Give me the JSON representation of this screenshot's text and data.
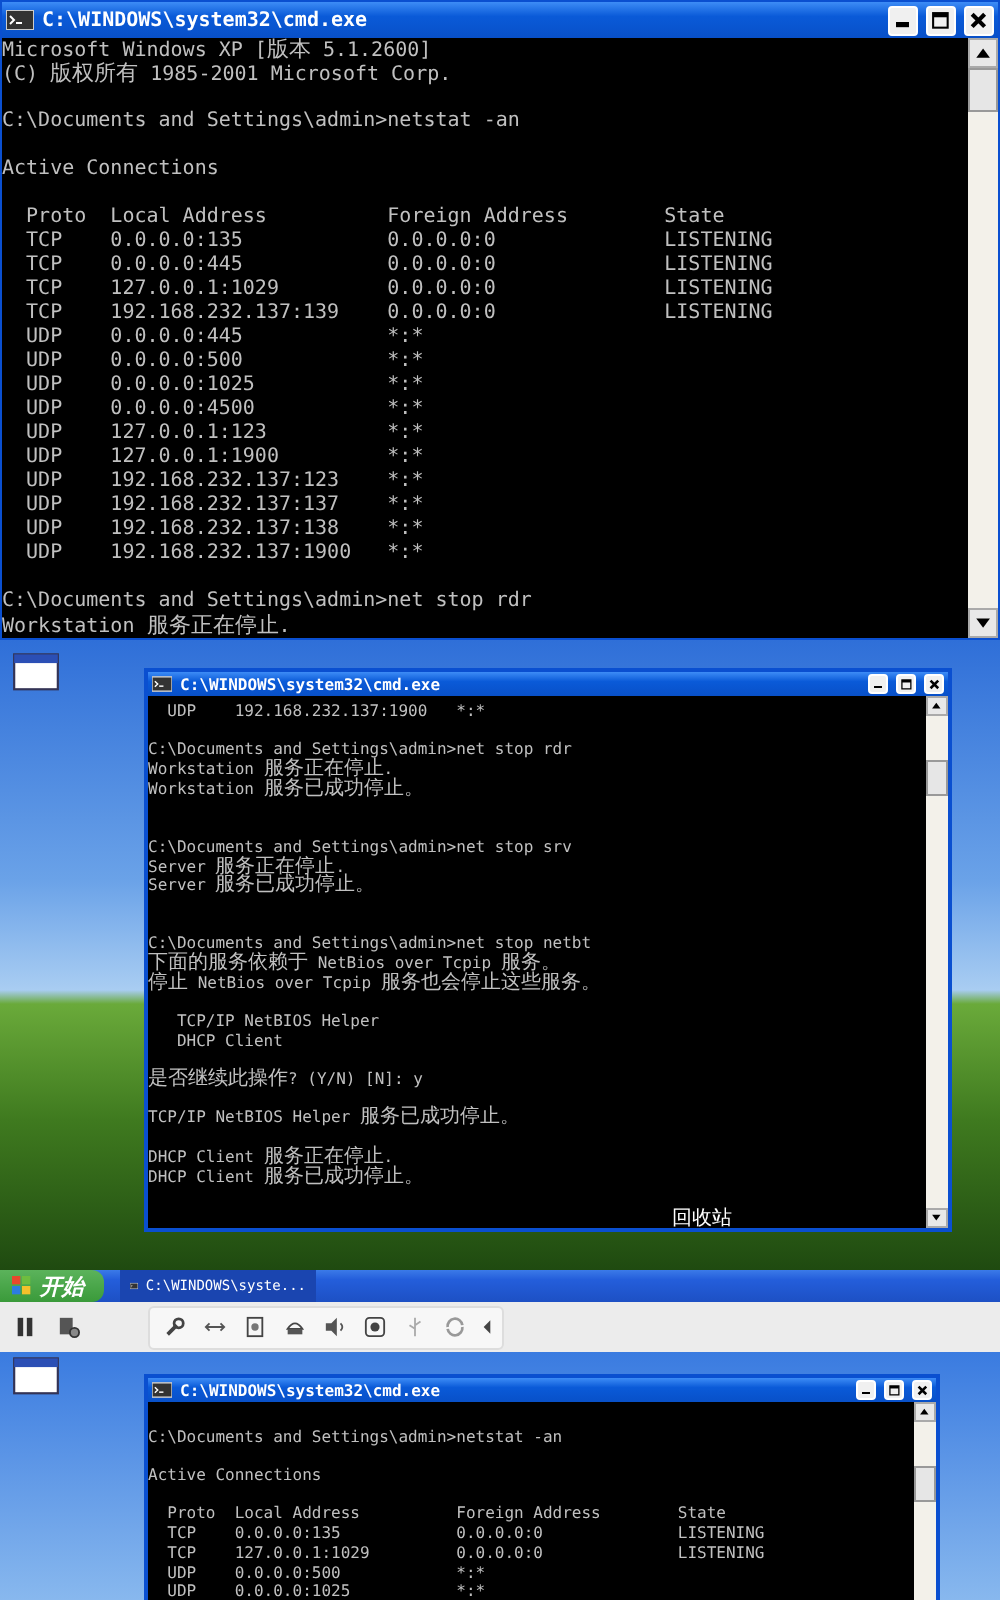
{
  "top_window": {
    "title": "C:\\WINDOWS\\system32\\cmd.exe",
    "lines": [
      {
        "kind": "text",
        "text": "Microsoft Windows XP [版本 5.1.2600]"
      },
      {
        "kind": "text",
        "text": "(C) 版权所有 1985-2001 Microsoft Corp."
      },
      {
        "kind": "blank"
      },
      {
        "kind": "text",
        "text": "C:\\Documents and Settings\\admin>netstat -an"
      },
      {
        "kind": "blank"
      },
      {
        "kind": "text",
        "text": "Active Connections"
      },
      {
        "kind": "blank"
      },
      {
        "kind": "text",
        "text": "  Proto  Local Address          Foreign Address        State"
      },
      {
        "kind": "text",
        "text": "  TCP    0.0.0.0:135            0.0.0.0:0              LISTENING"
      },
      {
        "kind": "text",
        "text": "  TCP    0.0.0.0:445            0.0.0.0:0              LISTENING"
      },
      {
        "kind": "text",
        "text": "  TCP    127.0.0.1:1029         0.0.0.0:0              LISTENING"
      },
      {
        "kind": "text",
        "text": "  TCP    192.168.232.137:139    0.0.0.0:0              LISTENING"
      },
      {
        "kind": "text",
        "text": "  UDP    0.0.0.0:445            *:*"
      },
      {
        "kind": "text",
        "text": "  UDP    0.0.0.0:500            *:*"
      },
      {
        "kind": "text",
        "text": "  UDP    0.0.0.0:1025           *:*"
      },
      {
        "kind": "text",
        "text": "  UDP    0.0.0.0:4500           *:*"
      },
      {
        "kind": "text",
        "text": "  UDP    127.0.0.1:123          *:*"
      },
      {
        "kind": "text",
        "text": "  UDP    127.0.0.1:1900         *:*"
      },
      {
        "kind": "text",
        "text": "  UDP    192.168.232.137:123    *:*"
      },
      {
        "kind": "text",
        "text": "  UDP    192.168.232.137:137    *:*"
      },
      {
        "kind": "text",
        "text": "  UDP    192.168.232.137:138    *:*"
      },
      {
        "kind": "text",
        "text": "  UDP    192.168.232.137:1900   *:*"
      },
      {
        "kind": "blank"
      },
      {
        "kind": "text",
        "text": "C:\\Documents and Settings\\admin>net stop rdr"
      },
      {
        "kind": "text",
        "text": "Workstation 服务正在停止."
      }
    ]
  },
  "middle_desktop": {
    "window": {
      "title": "C:\\WINDOWS\\system32\\cmd.exe",
      "lines": [
        {
          "kind": "text",
          "text": "  UDP    192.168.232.137:1900   *:*"
        },
        {
          "kind": "blank"
        },
        {
          "kind": "text",
          "text": "C:\\Documents and Settings\\admin>net stop rdr"
        },
        {
          "kind": "text",
          "text": "Workstation 服务正在停止."
        },
        {
          "kind": "text",
          "text": "Workstation 服务已成功停止。"
        },
        {
          "kind": "blank"
        },
        {
          "kind": "blank"
        },
        {
          "kind": "text",
          "text": "C:\\Documents and Settings\\admin>net stop srv"
        },
        {
          "kind": "text",
          "text": "Server 服务正在停止."
        },
        {
          "kind": "text",
          "text": "Server 服务已成功停止。"
        },
        {
          "kind": "blank"
        },
        {
          "kind": "blank"
        },
        {
          "kind": "text",
          "text": "C:\\Documents and Settings\\admin>net stop netbt"
        },
        {
          "kind": "text",
          "text": "下面的服务依赖于 NetBios over Tcpip 服务。"
        },
        {
          "kind": "text",
          "text": "停止 NetBios over Tcpip 服务也会停止这些服务。"
        },
        {
          "kind": "blank"
        },
        {
          "kind": "text",
          "text": "   TCP/IP NetBIOS Helper"
        },
        {
          "kind": "text",
          "text": "   DHCP Client"
        },
        {
          "kind": "blank"
        },
        {
          "kind": "text",
          "text": "是否继续此操作? (Y/N) [N]: y"
        },
        {
          "kind": "blank"
        },
        {
          "kind": "text",
          "text": "TCP/IP NetBIOS Helper 服务已成功停止。"
        },
        {
          "kind": "blank"
        },
        {
          "kind": "text",
          "text": "DHCP Client 服务正在停止."
        },
        {
          "kind": "text",
          "text": "DHCP Client 服务已成功停止。"
        }
      ]
    },
    "recycle_bin_label": "回收站",
    "taskbar": {
      "start_label": "开始",
      "tasks": [
        {
          "label": "C:\\WINDOWS\\syste..."
        }
      ]
    }
  },
  "bottom_desktop": {
    "window": {
      "title": "C:\\WINDOWS\\system32\\cmd.exe",
      "lines": [
        {
          "kind": "blank"
        },
        {
          "kind": "text",
          "text": "C:\\Documents and Settings\\admin>netstat -an"
        },
        {
          "kind": "blank"
        },
        {
          "kind": "text",
          "text": "Active Connections"
        },
        {
          "kind": "blank"
        },
        {
          "kind": "text",
          "text": "  Proto  Local Address          Foreign Address        State"
        },
        {
          "kind": "text",
          "text": "  TCP    0.0.0.0:135            0.0.0.0:0              LISTENING"
        },
        {
          "kind": "text",
          "text": "  TCP    127.0.0.1:1029         0.0.0.0:0              LISTENING"
        },
        {
          "kind": "text",
          "text": "  UDP    0.0.0.0:500            *:*"
        },
        {
          "kind": "text",
          "text": "  UDP    0.0.0.0:1025           *:*"
        }
      ]
    }
  }
}
